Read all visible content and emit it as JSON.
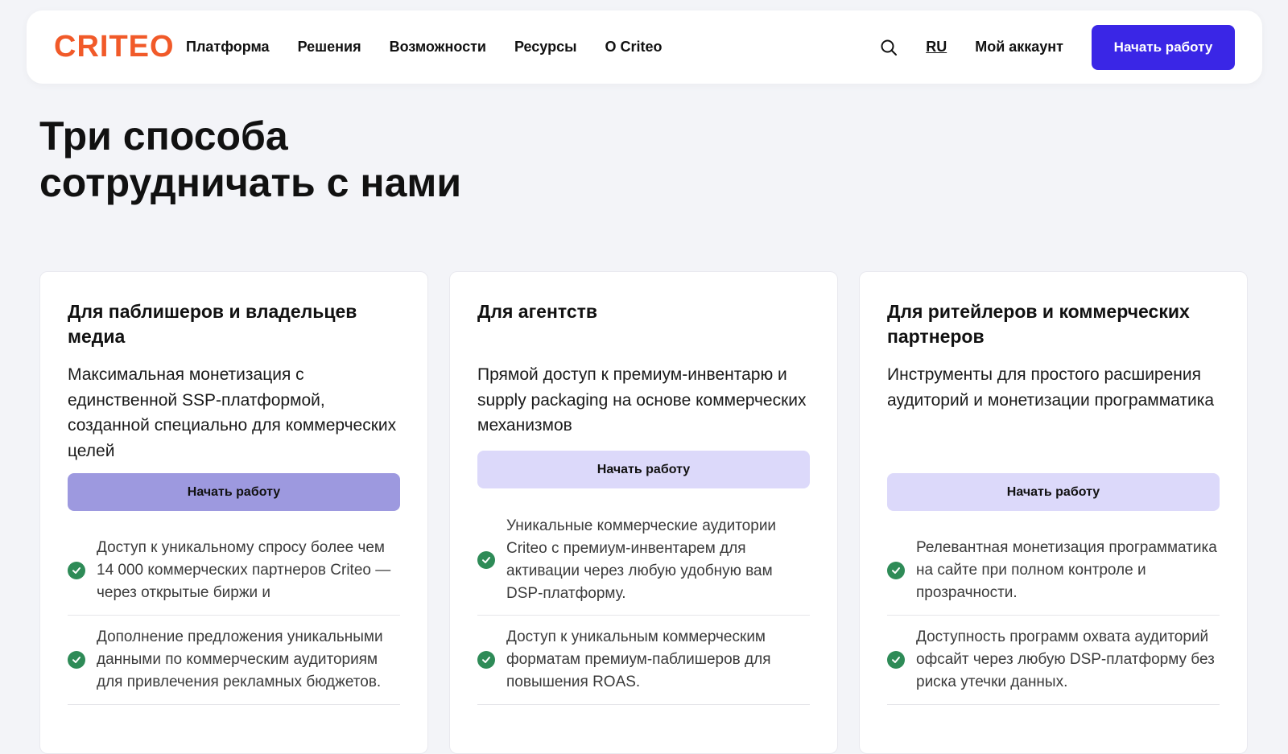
{
  "nav": {
    "logo": "CRITEO",
    "links": [
      "Платформа",
      "Решения",
      "Возможности",
      "Ресурсы",
      "О Criteo"
    ],
    "search_icon": "search-icon",
    "language": "RU",
    "account": "Мой аккаунт",
    "cta": "Начать работу",
    "accent_color": "#3a26e6",
    "logo_color": "#f15a29"
  },
  "hero": {
    "title_line1": "Три способа",
    "title_line2": "сотрудничать с нами"
  },
  "cards": [
    {
      "title": "Для паблишеров и владельцев медиа",
      "description": "Максимальная монетизация с единственной SSP-платформой, созданной специально для коммерческих целей",
      "button": "Начать работу",
      "features": [
        "Доступ к уникальному спросу более чем 14 000 коммерческих партнеров Criteo — через открытые биржи и",
        "Дополнение предложения уникальными данными по коммерческим аудиториям для привлечения рекламных бюджетов."
      ]
    },
    {
      "title": "Для агентств",
      "description": "Прямой доступ к премиум-инвентарю и supply packaging на основе коммерческих механизмов",
      "button": "Начать работу",
      "features": [
        "Уникальные коммерческие аудитории Criteo с премиум-инвентарем для активации через любую удобную вам DSP-платформу.",
        "Доступ к уникальным коммерческим форматам премиум-паблишеров для повышения ROAS."
      ]
    },
    {
      "title": "Для ритейлеров и коммерческих партнеров",
      "description": "Инструменты для простого расширения аудиторий и монетизации программатика",
      "button": "Начать работу",
      "features": [
        "Релевантная монетизация программатика на сайте при полном контроле и прозрачности.",
        "Доступность программ охвата аудиторий офсайт через любую DSP-платформу без риска утечки данных."
      ]
    }
  ]
}
